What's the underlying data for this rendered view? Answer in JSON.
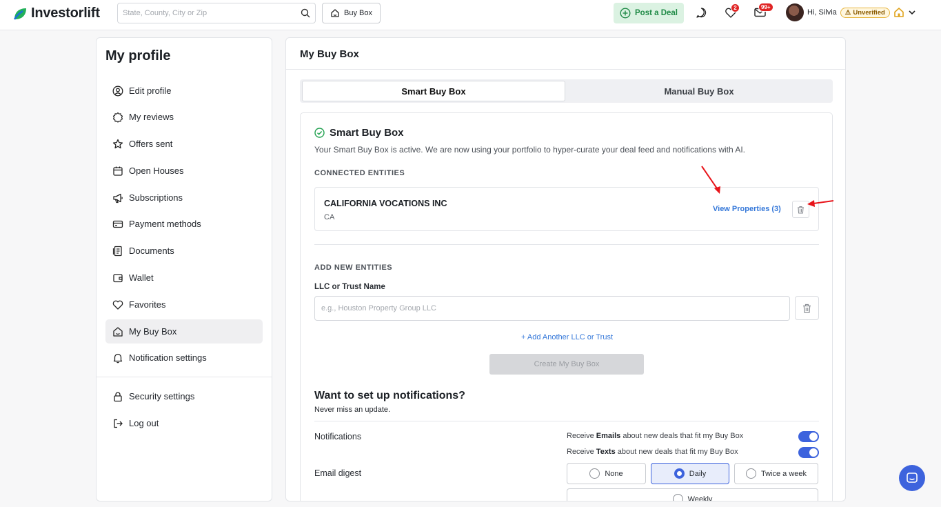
{
  "header": {
    "logo_text": "Investorlift",
    "search_placeholder": "State, County, City or Zip",
    "buy_box_label": "Buy Box",
    "post_deal_label": "Post a Deal",
    "favorites_badge": "2",
    "messages_badge": "99+",
    "greeting": "Hi, Silvia",
    "unverified_label": "Unverified"
  },
  "sidebar": {
    "title": "My profile",
    "items": [
      {
        "label": "Edit profile",
        "icon": "user-circle-icon"
      },
      {
        "label": "My reviews",
        "icon": "badge-star-icon"
      },
      {
        "label": "Offers sent",
        "icon": "star-icon"
      },
      {
        "label": "Open Houses",
        "icon": "calendar-icon"
      },
      {
        "label": "Subscriptions",
        "icon": "megaphone-icon"
      },
      {
        "label": "Payment methods",
        "icon": "credit-card-icon"
      },
      {
        "label": "Documents",
        "icon": "document-icon"
      },
      {
        "label": "Wallet",
        "icon": "wallet-icon"
      },
      {
        "label": "Favorites",
        "icon": "heart-icon"
      },
      {
        "label": "My Buy Box",
        "icon": "house-icon"
      },
      {
        "label": "Notification settings",
        "icon": "bell-icon"
      }
    ],
    "bottom_items": [
      {
        "label": "Security settings",
        "icon": "lock-icon"
      },
      {
        "label": "Log out",
        "icon": "logout-icon"
      }
    ],
    "active_item": "My Buy Box"
  },
  "main": {
    "title": "My Buy Box",
    "tabs": [
      {
        "label": "Smart Buy Box",
        "selected": true
      },
      {
        "label": "Manual Buy Box",
        "selected": false
      }
    ],
    "smart_buy_box": {
      "title": "Smart Buy Box",
      "description": "Your Smart Buy Box is active. We are now using your portfolio to hyper-curate your deal feed and notifications with AI.",
      "connected_heading": "CONNECTED ENTITIES",
      "entity": {
        "name": "CALIFORNIA VOCATIONS INC",
        "state": "CA",
        "view_properties": "View Properties (3)"
      },
      "add_heading": "ADD NEW ENTITIES",
      "field_label": "LLC or Trust Name",
      "field_placeholder": "e.g., Houston Property Group LLC",
      "add_another": "+ Add Another LLC or Trust",
      "create_button": "Create My Buy Box"
    },
    "notifications": {
      "title": "Want to set up notifications?",
      "subtitle": "Never miss an update.",
      "notifications_label": "Notifications",
      "email_toggle": {
        "prefix": "Receive ",
        "bold": "Emails",
        "suffix": " about new deals that fit my Buy Box",
        "on": true
      },
      "text_toggle": {
        "prefix": "Receive ",
        "bold": "Texts",
        "suffix": " about new deals that fit my Buy Box",
        "on": true
      },
      "digest_label": "Email digest",
      "digest_options": [
        "None",
        "Daily",
        "Twice a week",
        "Weekly"
      ],
      "digest_selected": "Daily"
    }
  },
  "colors": {
    "brand_green": "#1f8a46",
    "accent_blue": "#3d63dd",
    "link_blue": "#3578d9",
    "annotation_red": "#e8141a"
  }
}
